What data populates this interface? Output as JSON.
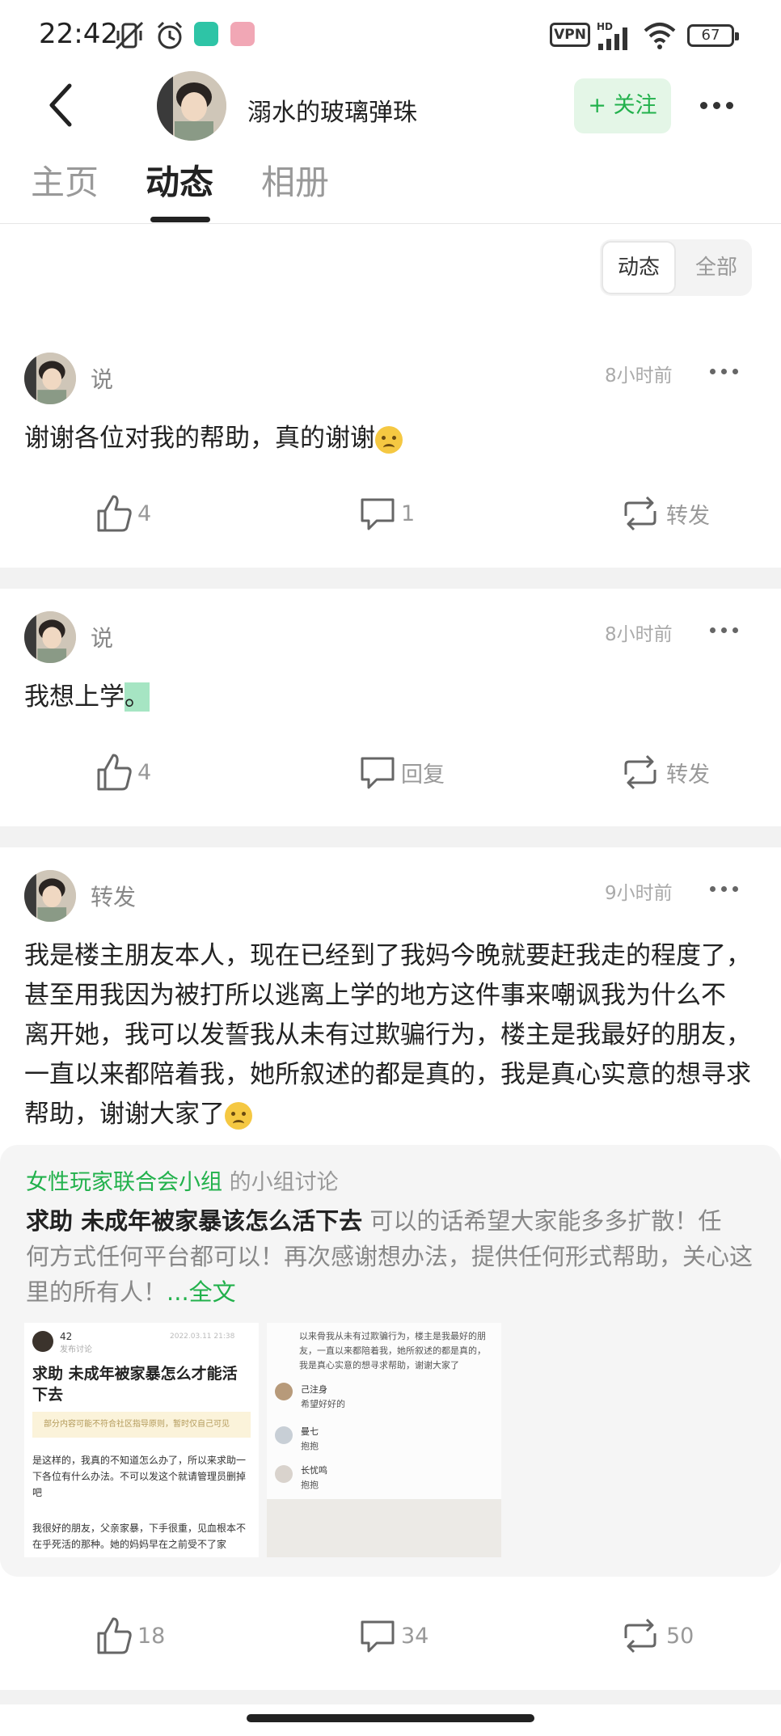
{
  "status_bar": {
    "time": "22:42",
    "vpn": "VPN",
    "network": "HD",
    "battery": "67",
    "icons": [
      "mute-vibrate-icon",
      "alarm-icon",
      "wechat-app-icon",
      "pink-app-icon",
      "signal-icon",
      "wifi-icon"
    ]
  },
  "header": {
    "username": "溺水的玻璃弹珠",
    "follow_label": "+ 关注"
  },
  "tabs": [
    {
      "label": "主页"
    },
    {
      "label": "动态"
    },
    {
      "label": "相册"
    }
  ],
  "filter": {
    "active": "动态",
    "other": "全部"
  },
  "posts": [
    {
      "type": "说",
      "time": "8小时前",
      "text": "谢谢各位对我的帮助，真的谢谢",
      "likes": "4",
      "comments": "1",
      "repost": "转发"
    },
    {
      "type": "说",
      "time": "8小时前",
      "text_main": "我想上学",
      "text_highlight": "。",
      "likes": "4",
      "comments": "回复",
      "repost": "转发"
    },
    {
      "type": "转发",
      "time": "9小时前",
      "lines": [
        "我是楼主朋友本人，现在已经到了我妈今晚就要赶我走的程度了，",
        "甚至用我因为被打所以逃离上学的地方这件事来嘲讽我为什么不",
        "离开她，我可以发誓我从未有过欺骗行为，楼主是我最好的朋友，",
        "一直以来都陪着我，她所叙述的都是真的，我是真心实意的想寻求",
        "帮助，谢谢大家了"
      ],
      "likes": "18",
      "comments": "34",
      "reposts": "50"
    }
  ],
  "shared": {
    "group": "女性玩家联合会小组",
    "group_suffix": " 的小组讨论",
    "title": "求助 未成年被家暴该怎么活下去",
    "body_lines": [
      "  可以的话希望大家能多多扩散！任",
      "何方式任何平台都可以！再次感谢想办法，提供任何形式帮助，关心这",
      "里的所有人！"
    ],
    "full_text": "...全文",
    "thumb1": {
      "count": "42",
      "sub": "发布讨论",
      "date": "2022.03.11 21:38",
      "title": "求助 未成年被家暴怎么才能活下去",
      "notice": "部分内容可能不符合社区指导原则，暂时仅自己可见",
      "p1": "是这样的，我真的不知道怎么办了，所以来求助一下各位有什么办法。不可以发这个就请管理员删掉吧",
      "p2": "我很好的朋友，父亲家暴，下手很重，见血根本不在乎死活的那种。她的妈妈早在之前受不了家"
    },
    "thumb2": {
      "lines": [
        "以来骨我从未有过欺骗行为，楼主是我最好的朋",
        "友，一直以来都陪着我，她所叙述的都是真的，",
        "我是真心实意的想寻求帮助，谢谢大家了"
      ],
      "comments": [
        {
          "name": "己注身",
          "reply": "希望好好的"
        },
        {
          "name": "曼七",
          "reply": "抱抱"
        },
        {
          "name": "长忧鸣",
          "reply": "抱抱"
        }
      ]
    }
  }
}
